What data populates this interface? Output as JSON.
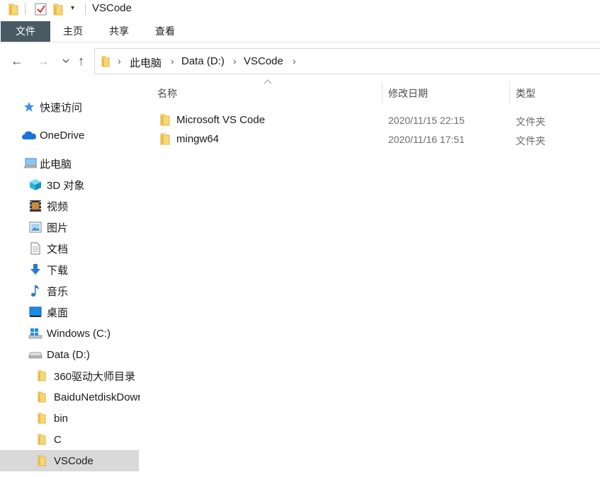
{
  "window": {
    "title": "VSCode"
  },
  "quick_access_toolbar": {
    "dropdown_glyph": "▾"
  },
  "ribbon": {
    "tabs": [
      {
        "label": "文件",
        "active": true
      },
      {
        "label": "主页"
      },
      {
        "label": "共享"
      },
      {
        "label": "查看"
      }
    ]
  },
  "nav_buttons": {
    "back": "←",
    "forward": "→",
    "recent": "⌄",
    "up": "↑"
  },
  "address": {
    "breadcrumbs": [
      "此电脑",
      "Data (D:)",
      "VSCode"
    ],
    "separator": "›"
  },
  "sidebar": {
    "items": [
      {
        "label": "快速访问",
        "icon": "star-icon"
      },
      {
        "label": "OneDrive",
        "icon": "cloud-icon"
      },
      {
        "label": "此电脑",
        "icon": "computer-icon"
      },
      {
        "label": "3D 对象",
        "icon": "cube-icon"
      },
      {
        "label": "视频",
        "icon": "video-icon"
      },
      {
        "label": "图片",
        "icon": "picture-icon"
      },
      {
        "label": "文档",
        "icon": "document-icon"
      },
      {
        "label": "下载",
        "icon": "download-icon"
      },
      {
        "label": "音乐",
        "icon": "music-icon"
      },
      {
        "label": "桌面",
        "icon": "desktop-icon"
      },
      {
        "label": "Windows (C:)",
        "icon": "windows-drive-icon"
      },
      {
        "label": "Data (D:)",
        "icon": "drive-icon"
      },
      {
        "label": "360驱动大师目录",
        "icon": "folder-icon"
      },
      {
        "label": "BaiduNetdiskDownload",
        "icon": "folder-icon"
      },
      {
        "label": "bin",
        "icon": "folder-icon"
      },
      {
        "label": "C",
        "icon": "folder-icon"
      },
      {
        "label": "VSCode",
        "icon": "folder-icon",
        "selected": true
      }
    ]
  },
  "file_list": {
    "columns": {
      "name": "名称",
      "date": "修改日期",
      "type": "类型"
    },
    "sort_glyph": "^",
    "rows": [
      {
        "name": "Microsoft VS Code",
        "date": "2020/11/15 22:15",
        "type": "文件夹"
      },
      {
        "name": "mingw64",
        "date": "2020/11/16 17:51",
        "type": "文件夹"
      }
    ]
  },
  "colors": {
    "file_tab_bg": "#4a5a64",
    "folder_yellow": "#f8d775",
    "selected_bg": "#d9d9d9"
  }
}
